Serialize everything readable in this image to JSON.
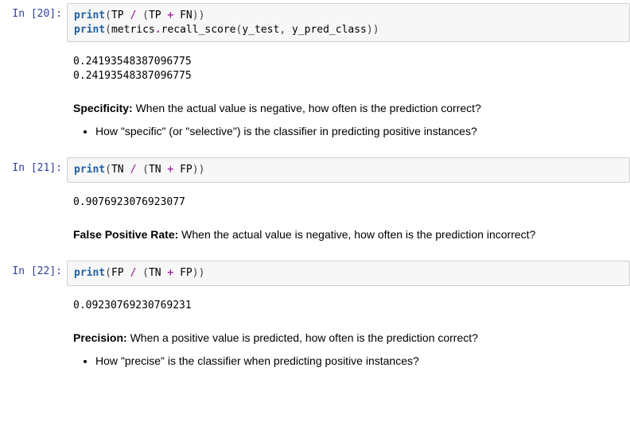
{
  "cells": {
    "c20": {
      "prompt": "In [20]:",
      "code": {
        "l1_print": "print",
        "l1_lp": "(",
        "l1_a": "TP",
        "l1_div": " / ",
        "l1_lp2": "(",
        "l1_b": "TP",
        "l1_plus": " + ",
        "l1_c": "FN",
        "l1_rp2": ")",
        "l1_rp": ")",
        "l2_print": "print",
        "l2_lp": "(",
        "l2_a": "metrics",
        "l2_dot": ".",
        "l2_b": "recall_score",
        "l2_lp2": "(",
        "l2_c": "y_test",
        "l2_comma": ", ",
        "l2_d": "y_pred_class",
        "l2_rp2": ")",
        "l2_rp": ")"
      },
      "output": "0.24193548387096775\n0.24193548387096775"
    },
    "md1": {
      "bold": "Specificity:",
      "text": " When the actual value is negative, how often is the prediction correct?",
      "bullet": "How \"specific\" (or \"selective\") is the classifier in predicting positive instances?"
    },
    "c21": {
      "prompt": "In [21]:",
      "code": {
        "l1_print": "print",
        "l1_lp": "(",
        "l1_a": "TN",
        "l1_div": " / ",
        "l1_lp2": "(",
        "l1_b": "TN",
        "l1_plus": " + ",
        "l1_c": "FP",
        "l1_rp2": ")",
        "l1_rp": ")"
      },
      "output": "0.9076923076923077"
    },
    "md2": {
      "bold": "False Positive Rate:",
      "text": " When the actual value is negative, how often is the prediction incorrect?"
    },
    "c22": {
      "prompt": "In [22]:",
      "code": {
        "l1_print": "print",
        "l1_lp": "(",
        "l1_a": "FP",
        "l1_div": " / ",
        "l1_lp2": "(",
        "l1_b": "TN",
        "l1_plus": " + ",
        "l1_c": "FP",
        "l1_rp2": ")",
        "l1_rp": ")"
      },
      "output": "0.09230769230769231"
    },
    "md3": {
      "bold": "Precision:",
      "text": " When a positive value is predicted, how often is the prediction correct?",
      "bullet": "How \"precise\" is the classifier when predicting positive instances?"
    }
  }
}
